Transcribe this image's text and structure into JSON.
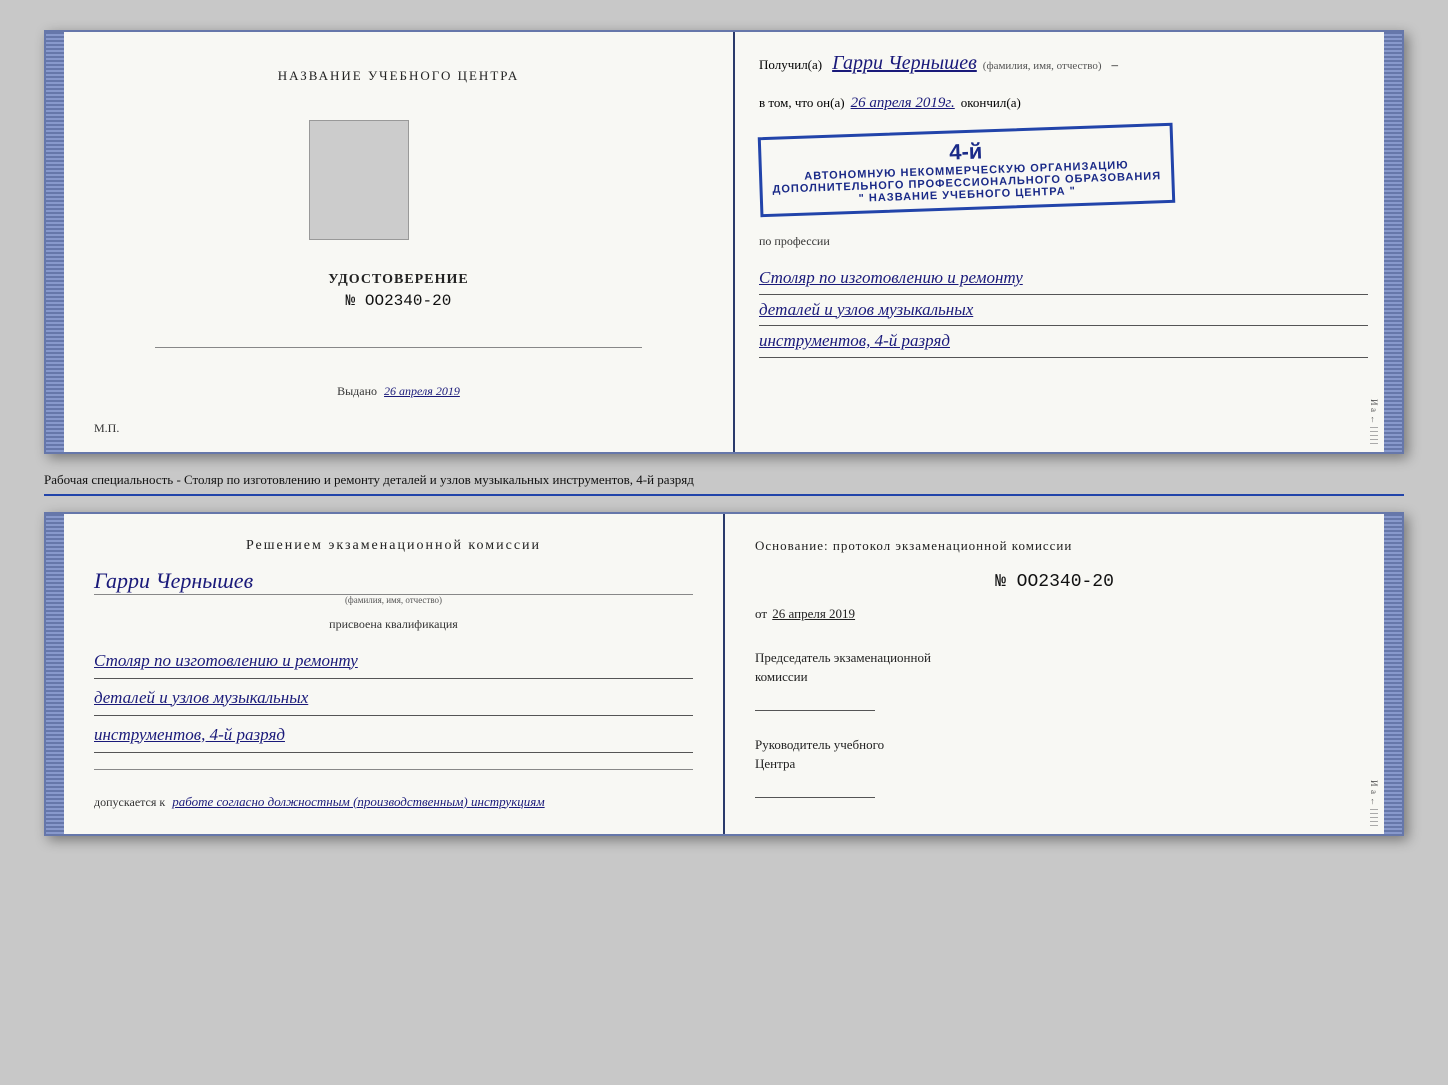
{
  "doc1": {
    "left": {
      "title": "НАЗВАНИЕ УЧЕБНОГО ЦЕНТРА",
      "udostoverenie": "УДОСТОВЕРЕНИЕ",
      "number": "№ OO2340-20",
      "vydano_label": "Выдано",
      "vydano_date": "26 апреля 2019",
      "mp": "М.П."
    },
    "right": {
      "poluchil": "Получил(а)",
      "fio": "Гарри Чернышев",
      "fio_label": "(фамилия, имя, отчество)",
      "vtom_prefix": "в том, что он(а)",
      "date": "26 апреля 2019г.",
      "okonchil": "окончил(а)",
      "stamp_line1": "АВТОНОМНУЮ НЕКОММЕРЧЕСКУЮ ОРГАНИЗАЦИЮ",
      "stamp_line2": "ДОПОЛНИТЕЛЬНОГО ПРОФЕССИОНАЛЬНОГО ОБРАЗОВАНИЯ",
      "stamp_line3": "\" НАЗВАНИЕ УЧЕБНОГО ЦЕНТРА \"",
      "stamp_number": "4-й",
      "po_professii": "по профессии",
      "profession_line1": "Столяр по изготовлению и ремонту",
      "profession_line2": "деталей и узлов музыкальных",
      "profession_line3": "инструментов, 4-й разряд"
    }
  },
  "caption": "Рабочая специальность - Столяр по изготовлению и ремонту деталей и узлов музыкальных инструментов, 4-й разряд",
  "doc2": {
    "left": {
      "resheniem": "Решением  экзаменационной  комиссии",
      "fio": "Гарри Чернышев",
      "fio_label": "(фамилия, имя, отчество)",
      "prisvoena": "присвоена квалификация",
      "kvalif_line1": "Столяр по изготовлению и ремонту",
      "kvalif_line2": "деталей и узлов музыкальных",
      "kvalif_line3": "инструментов, 4-й разряд",
      "dopuskaetsya": "допускается к",
      "dopusk_text": "работе согласно должностным (производственным) инструкциям"
    },
    "right": {
      "osnovanie": "Основание: протокол экзаменационной  комиссии",
      "number": "№  OO2340-20",
      "ot_prefix": "от",
      "ot_date": "26 апреля 2019",
      "predsedatel_line1": "Председатель экзаменационной",
      "predsedatel_line2": "комиссии",
      "rukovoditel_line1": "Руководитель учебного",
      "rukovoditel_line2": "Центра"
    }
  },
  "right_edge": {
    "chars": "И а ←"
  }
}
